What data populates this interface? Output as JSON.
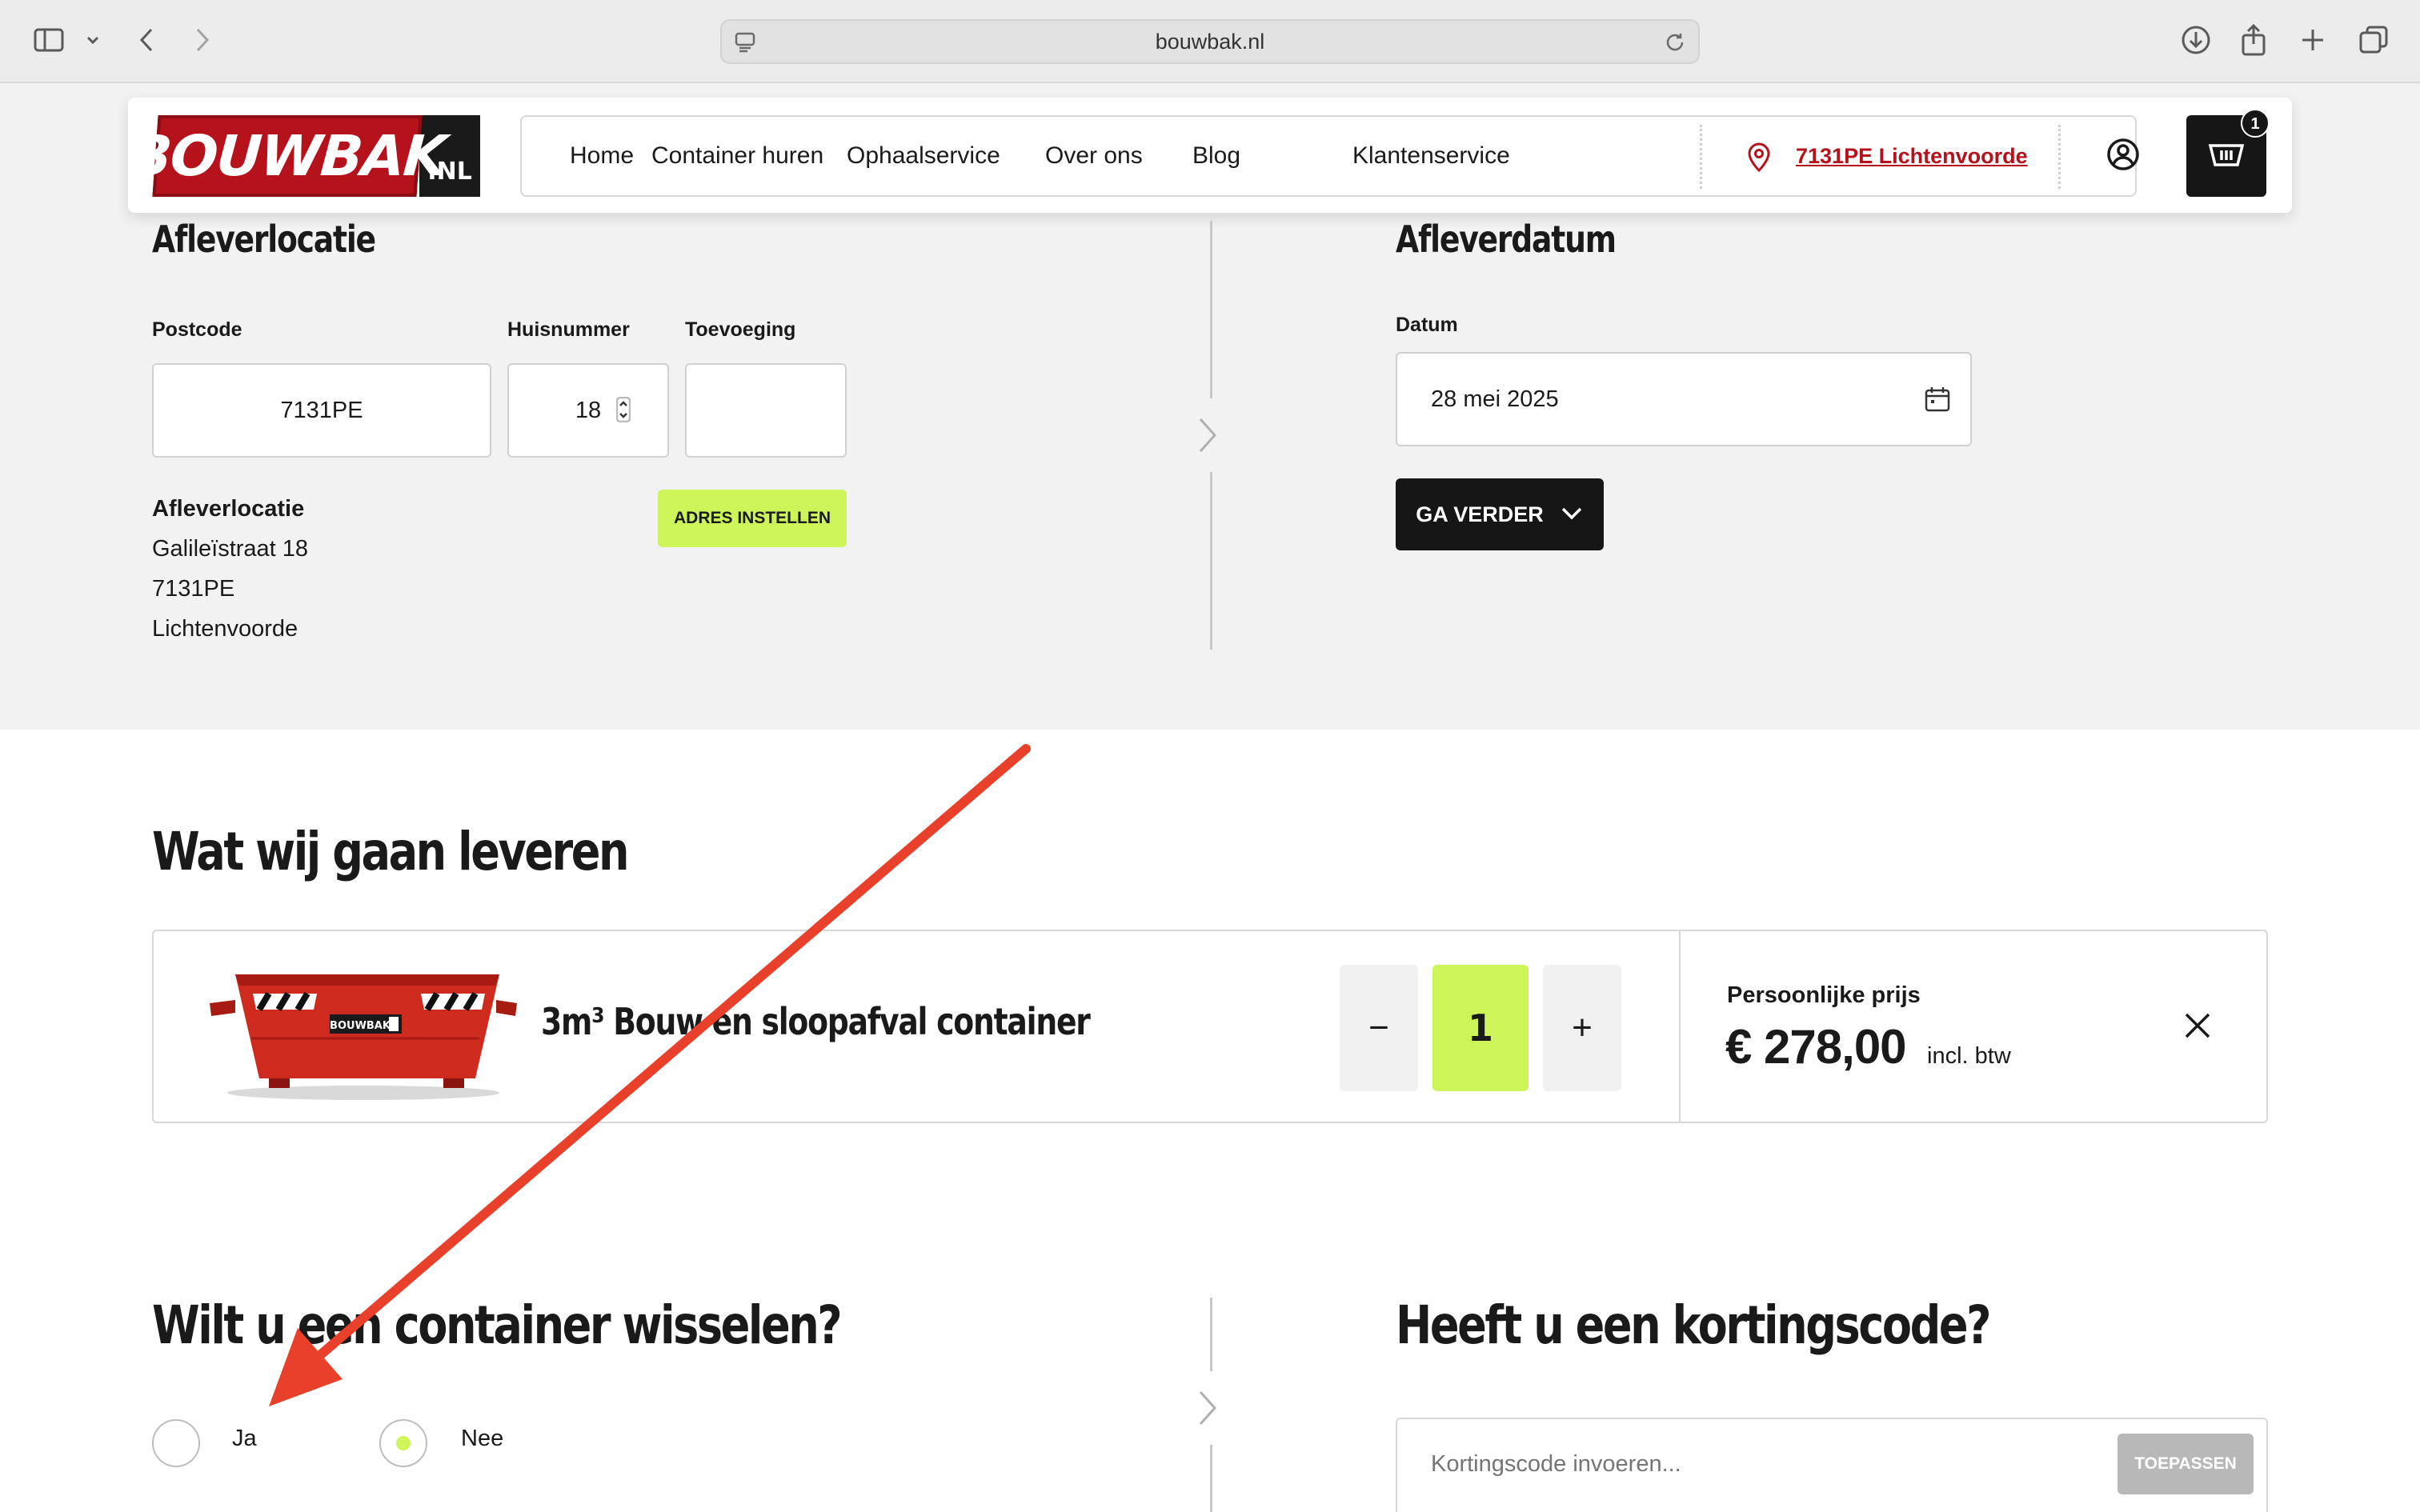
{
  "browser": {
    "url": "bouwbak.nl"
  },
  "header": {
    "logo_main": "BOUWBAK",
    "logo_suffix": ".NL",
    "nav": [
      "Home",
      "Container huren",
      "Ophaalservice",
      "Over ons",
      "Blog",
      "Klantenservice"
    ],
    "location": "7131PE Lichtenvoorde",
    "cart_count": "1"
  },
  "delivery_location": {
    "title": "Afleverlocatie",
    "postcode_label": "Postcode",
    "postcode_value": "7131PE",
    "housenumber_label": "Huisnummer",
    "housenumber_value": "18",
    "addition_label": "Toevoeging",
    "addition_value": "",
    "address_title": "Afleverlocatie",
    "address_lines": [
      "Galileïstraat 18",
      "7131PE",
      "Lichtenvoorde"
    ],
    "set_address_button": "ADRES INSTELLEN"
  },
  "delivery_date": {
    "title": "Afleverdatum",
    "date_label": "Datum",
    "date_value": "28 mei 2025",
    "continue_button": "GA VERDER"
  },
  "order": {
    "title": "Wat wij gaan leveren",
    "product_name": "3m³ Bouw en sloopafval container",
    "product_image_brand": "BOUWBAK",
    "quantity": "1",
    "minus": "−",
    "plus": "+",
    "price_label": "Persoonlijke prijs",
    "price_value": "€ 278,00",
    "price_suffix": "incl. btw"
  },
  "swap": {
    "title": "Wilt u een container wisselen?",
    "options": [
      "Ja",
      "Nee"
    ],
    "selected": "Nee"
  },
  "discount": {
    "title": "Heeft u een kortingscode?",
    "placeholder": "Kortingscode invoeren...",
    "apply_button": "TOEPASSEN"
  },
  "colors": {
    "brand_red": "#b5121b",
    "accent_green": "#cdf55a",
    "dark": "#161616",
    "annotation_arrow": "#e8402a"
  }
}
